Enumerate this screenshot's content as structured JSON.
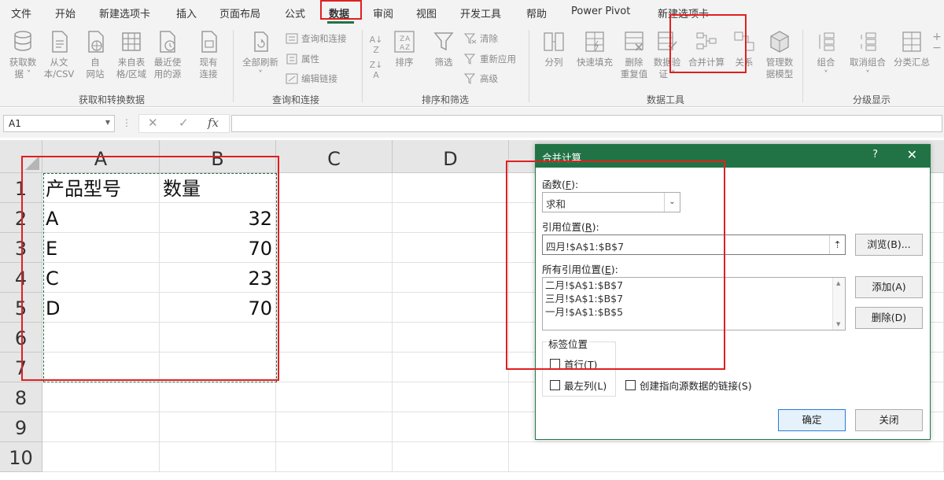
{
  "ribbon_tabs": [
    {
      "label": "文件"
    },
    {
      "label": "开始"
    },
    {
      "label": "新建选项卡"
    },
    {
      "label": "插入"
    },
    {
      "label": "页面布局"
    },
    {
      "label": "公式"
    },
    {
      "label": "数据"
    },
    {
      "label": "审阅"
    },
    {
      "label": "视图"
    },
    {
      "label": "开发工具"
    },
    {
      "label": "帮助"
    },
    {
      "label": "Power Pivot"
    },
    {
      "label": "新建选项卡"
    }
  ],
  "active_tab": "数据",
  "ribbon": {
    "get_transform": {
      "label": "获取和转换数据",
      "get_data": "获取数\n据 ˅",
      "from_csv": "从文\n本/CSV",
      "from_web": "自\n网站",
      "from_table": "来自表\n格/区域",
      "recent_sources": "最近使\n用的源",
      "existing_connections": "现有\n连接"
    },
    "queries": {
      "label": "查询和连接",
      "refresh_all": "全部刷新\n˅",
      "queries_connections": "查询和连接",
      "properties": "属性",
      "edit_links": "编辑链接"
    },
    "sort_filter": {
      "label": "排序和筛选",
      "sort": "排序",
      "filter": "筛选",
      "clear": "清除",
      "reapply": "重新应用",
      "advanced": "高级"
    },
    "data_tools": {
      "label": "数据工具",
      "text_to_columns": "分列",
      "flash_fill": "快速填充",
      "remove_duplicates": "删除\n重复值",
      "data_validation": "数据验\n证 ˅",
      "consolidate": "合并计算",
      "relationships": "关系",
      "manage_model": "管理数\n据模型"
    },
    "outline": {
      "label": "分级显示",
      "group": "组合\n˅",
      "ungroup": "取消组合\n˅",
      "subtotal": "分类汇总"
    }
  },
  "formula_bar": {
    "name_box": "A1",
    "cancel": "✕",
    "enter": "✓",
    "fx": "fx",
    "formula": ""
  },
  "sheet": {
    "columns": [
      "A",
      "B",
      "C",
      "D"
    ],
    "rows": [
      "1",
      "2",
      "3",
      "4",
      "5",
      "6",
      "7",
      "8",
      "9",
      "10"
    ],
    "cells": [
      [
        "产品型号",
        "数量"
      ],
      [
        "A",
        "32"
      ],
      [
        "E",
        "70"
      ],
      [
        "C",
        "23"
      ],
      [
        "D",
        "70"
      ]
    ]
  },
  "dialog": {
    "title": "合并计算",
    "help": "?",
    "close": "✕",
    "function_label": "函数(",
    "function_key": "F",
    "function_label_end": "):",
    "function_value": "求和",
    "reference_label": "引用位置(",
    "reference_key": "R",
    "reference_label_end": "):",
    "reference_value": "四月!$A$1:$B$7",
    "browse_button": "浏览(B)...",
    "all_refs_label": "所有引用位置(",
    "all_refs_key": "E",
    "all_refs_label_end": "):",
    "all_refs": [
      "二月!$A$1:$B$7",
      "三月!$A$1:$B$7",
      "一月!$A$1:$B$5"
    ],
    "add_button": "添加(A)",
    "delete_button": "删除(D)",
    "label_position": "标签位置",
    "top_row": "首行(T)",
    "left_column": "最左列(L)",
    "create_links": "创建指向源数据的链接(S)",
    "ok_button": "确定",
    "close_button": "关闭"
  }
}
